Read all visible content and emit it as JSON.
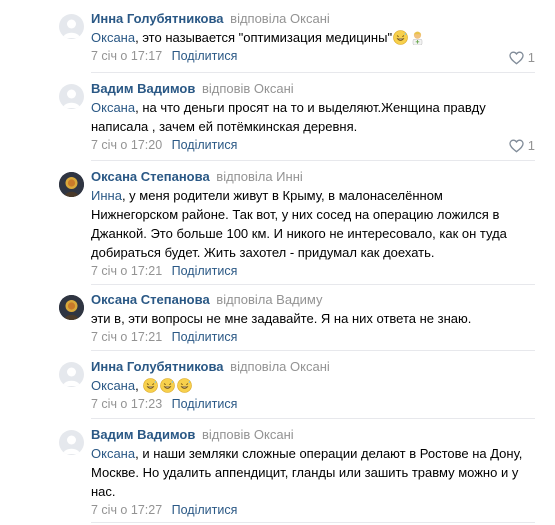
{
  "comments": [
    {
      "author": "Инна Голубятникова",
      "replied": "відповіла Оксані",
      "mention": "Оксана",
      "text": ", это называется \"оптимизация медицины\"",
      "emojis": [
        "grinning-sweat-emoji",
        "health-worker-emoji"
      ],
      "date": "7 січ о 17:17",
      "share": "Поділитися",
      "likes": "1"
    },
    {
      "author": "Вадим Вадимов",
      "replied": "відповів Оксані",
      "mention": "Оксана",
      "text": ", на что деньги просят на то и выделяют.Женщина правду",
      "text2": "написала , зачем ей потёмкинская деревня.",
      "date": "7 січ о 17:20",
      "share": "Поділитися",
      "likes": "1"
    },
    {
      "author": "Оксана Степанова",
      "replied": "відповіла Инні",
      "mention": "Инна",
      "text": ", у меня родители живут в Крыму, в малонаселённом",
      "text2": "Нижнегорском районе. Так вот, у них сосед на операцию ложился в",
      "text3": "Джанкой. Это больше 100 км. И никого не интересовало, как он туда",
      "text4": "добираться будет. Жить захотел - придумал как доехать.",
      "date": "7 січ о 17:21",
      "share": "Поділитися"
    },
    {
      "author": "Оксана Степанова",
      "replied": "відповіла Вадиму",
      "text": "эти в, эти вопросы не мне задавайте. Я на них ответа не знаю.",
      "date": "7 січ о 17:21",
      "share": "Поділитися"
    },
    {
      "author": "Инна Голубятникова",
      "replied": "відповіла Оксані",
      "mention": "Оксана",
      "text": ",",
      "emojis": [
        "grinning-sweat-emoji",
        "grinning-sweat-emoji",
        "grinning-sweat-emoji"
      ],
      "date": "7 січ о 17:23",
      "share": "Поділитися"
    },
    {
      "author": "Вадим Вадимов",
      "replied": "відповів Оксані",
      "mention": "Оксана",
      "text": ", и наши земляки сложные операции делают в Ростове на Дону,",
      "text2": "Москве. Но удалить аппендицит, гланды или зашить травму можно и у",
      "text3": "нас.",
      "date": "7 січ о 17:27",
      "share": "Поділитися"
    }
  ],
  "colors": {
    "link": "#2a5885",
    "muted": "#939393",
    "separator": "#e7e8ec"
  }
}
